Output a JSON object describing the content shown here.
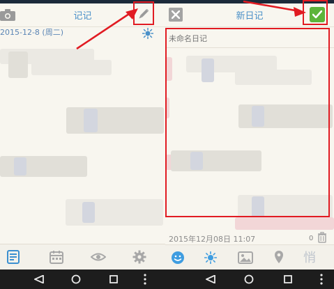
{
  "left_screen": {
    "title": "记记",
    "date": "2015-12-8 (周二)"
  },
  "right_screen": {
    "title": "新日记",
    "title_placeholder": "未命名日记",
    "footer_date": "2015年12月08日 11:07",
    "char_count": "0",
    "mood_label": "悄"
  },
  "colors": {
    "title_blue": "#4a90c8",
    "accent_green": "#5cb43a",
    "highlight_red": "#e11b22",
    "background": "#f8f6ef"
  }
}
